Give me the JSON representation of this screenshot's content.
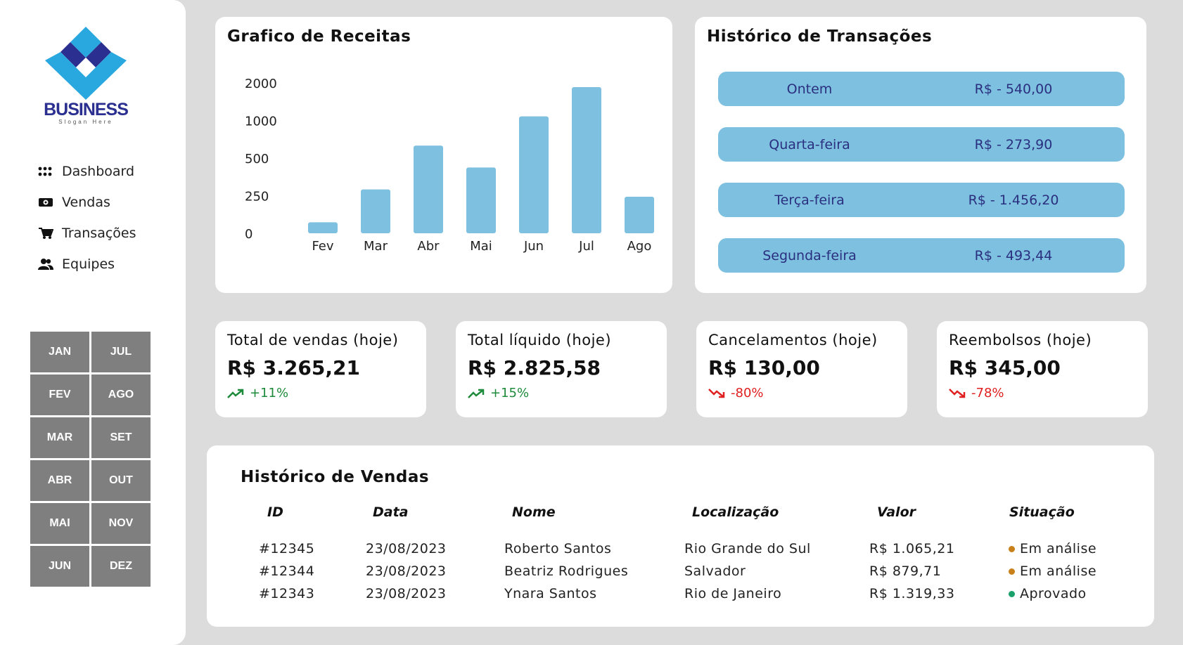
{
  "brand": {
    "name": "BUSINESS",
    "slogan": "Slogan Here"
  },
  "sidebar": {
    "items": [
      {
        "label": "Dashboard",
        "icon": "grid-icon"
      },
      {
        "label": "Vendas",
        "icon": "money-icon"
      },
      {
        "label": "Transações",
        "icon": "cart-icon"
      },
      {
        "label": "Equipes",
        "icon": "users-icon"
      }
    ],
    "months": [
      "JAN",
      "JUL",
      "FEV",
      "AGO",
      "MAR",
      "SET",
      "ABR",
      "OUT",
      "MAI",
      "NOV",
      "JUN",
      "DEZ"
    ]
  },
  "chart": {
    "title": "Grafico de Receitas"
  },
  "chart_data": {
    "type": "bar",
    "categories": [
      "Fev",
      "Mar",
      "Abr",
      "Mai",
      "Jun",
      "Jul",
      "Ago"
    ],
    "values": [
      150,
      600,
      1200,
      900,
      1600,
      2000,
      500
    ],
    "y_tick_labels": [
      "2000",
      "1000",
      "500",
      "250",
      "0"
    ],
    "bar_color": "#7dc0e0"
  },
  "transactions": {
    "title": "Histórico de Transações",
    "rows": [
      {
        "day": "Ontem",
        "value": "R$ - 540,00"
      },
      {
        "day": "Quarta-feira",
        "value": "R$ - 273,90"
      },
      {
        "day": "Terça-feira",
        "value": "R$ - 1.456,20"
      },
      {
        "day": "Segunda-feira",
        "value": "R$ - 493,44"
      }
    ]
  },
  "kpis": [
    {
      "label": "Total de vendas (hoje)",
      "value": "R$ 3.265,21",
      "change": "+11%",
      "trend": "up"
    },
    {
      "label": "Total líquido (hoje)",
      "value": "R$ 2.825,58",
      "change": "+15%",
      "trend": "up"
    },
    {
      "label": "Cancelamentos (hoje)",
      "value": "R$ 130,00",
      "change": "-80%",
      "trend": "down"
    },
    {
      "label": "Reembolsos (hoje)",
      "value": "R$ 345,00",
      "change": "-78%",
      "trend": "down"
    }
  ],
  "colors": {
    "up": "#1e8a3c",
    "down": "#e02020",
    "pending": "#c8801a",
    "approved": "#1aa06a"
  },
  "sales": {
    "title": "Histórico de Vendas",
    "headers": [
      "ID",
      "Data",
      "Nome",
      "Localização",
      "Valor",
      "Situação"
    ],
    "rows": [
      {
        "id": "#12345",
        "date": "23/08/2023",
        "name": "Roberto Santos",
        "location": "Rio Grande do Sul",
        "value": "R$ 1.065,21",
        "status": "Em análise",
        "status_color": "#c8801a"
      },
      {
        "id": "#12344",
        "date": "23/08/2023",
        "name": "Beatriz Rodrigues",
        "location": "Salvador",
        "value": "R$ 879,71",
        "status": "Em análise",
        "status_color": "#c8801a"
      },
      {
        "id": "#12343",
        "date": "23/08/2023",
        "name": "Ynara Santos",
        "location": "Rio de Janeiro",
        "value": "R$ 1.319,33",
        "status": "Aprovado",
        "status_color": "#1aa06a"
      }
    ]
  }
}
